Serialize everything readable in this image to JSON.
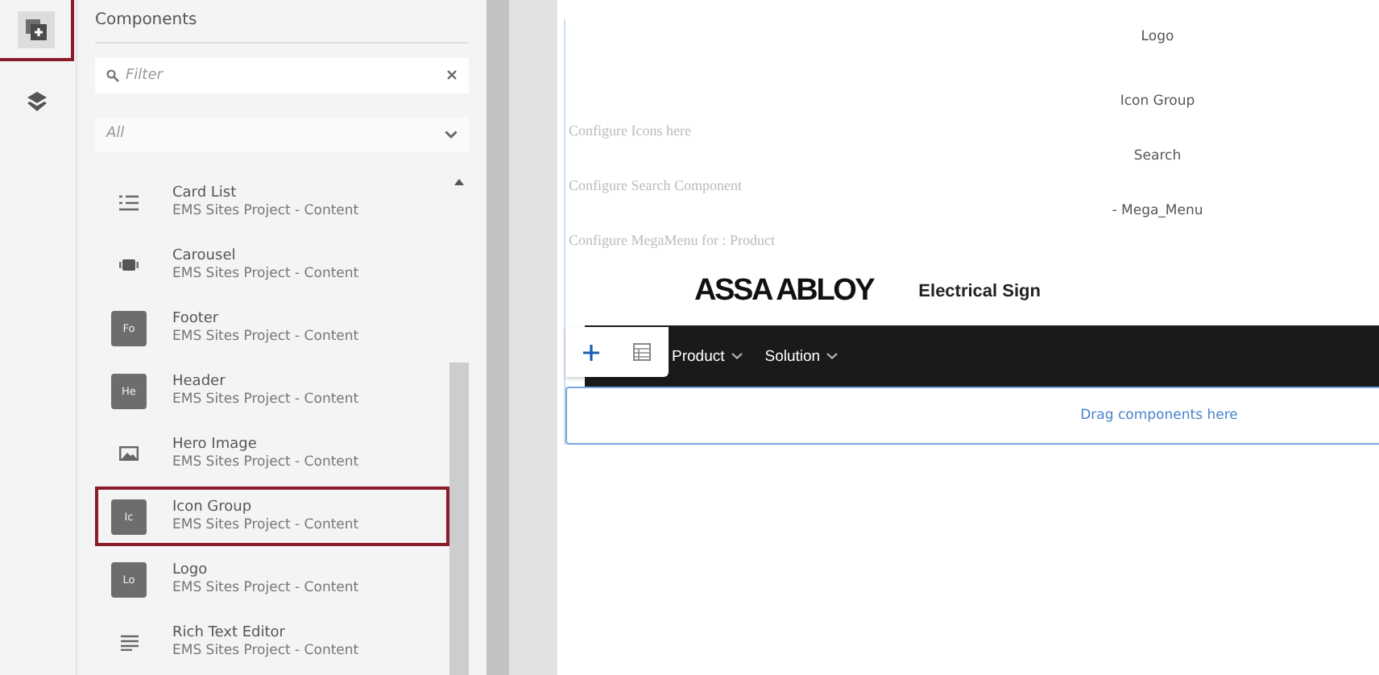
{
  "rail": [
    {
      "kind": "components",
      "selected": true
    },
    {
      "kind": "layers",
      "selected": false
    }
  ],
  "panel": {
    "title": "Components",
    "filter": {
      "placeholder": "Filter"
    },
    "group_select": {
      "value": "All"
    },
    "items": [
      {
        "name": "Card List",
        "group": "EMS Sites Project - Content",
        "kind": "list",
        "highlighted": false
      },
      {
        "name": "Carousel",
        "group": "EMS Sites Project - Content",
        "kind": "carousel",
        "highlighted": false
      },
      {
        "name": "Footer",
        "group": "EMS Sites Project - Content",
        "kind": "badge",
        "badge": "Fo",
        "highlighted": false
      },
      {
        "name": "Header",
        "group": "EMS Sites Project - Content",
        "kind": "badge",
        "badge": "He",
        "highlighted": false
      },
      {
        "name": "Hero Image",
        "group": "EMS Sites Project - Content",
        "kind": "image",
        "highlighted": false
      },
      {
        "name": "Icon Group",
        "group": "EMS Sites Project - Content",
        "kind": "badge",
        "badge": "Ic",
        "highlighted": true
      },
      {
        "name": "Logo",
        "group": "EMS Sites Project - Content",
        "kind": "badge",
        "badge": "Lo",
        "highlighted": false
      },
      {
        "name": "Rich Text Editor",
        "group": "EMS Sites Project - Content",
        "kind": "text",
        "highlighted": false
      }
    ]
  },
  "canvas": {
    "blocks": [
      {
        "label": "Logo"
      },
      {
        "label": "Icon Group",
        "hint": "Configure Icons here"
      },
      {
        "label": "Search",
        "hint": "Configure Search Component"
      },
      {
        "label": "- Mega_Menu",
        "hint": "Configure MegaMenu for : Product"
      }
    ],
    "brand": "ASSA ABLOY",
    "site_name": "Electrical Sign",
    "nav": [
      "Product",
      "Solution"
    ],
    "dropzone": "Drag components here"
  }
}
